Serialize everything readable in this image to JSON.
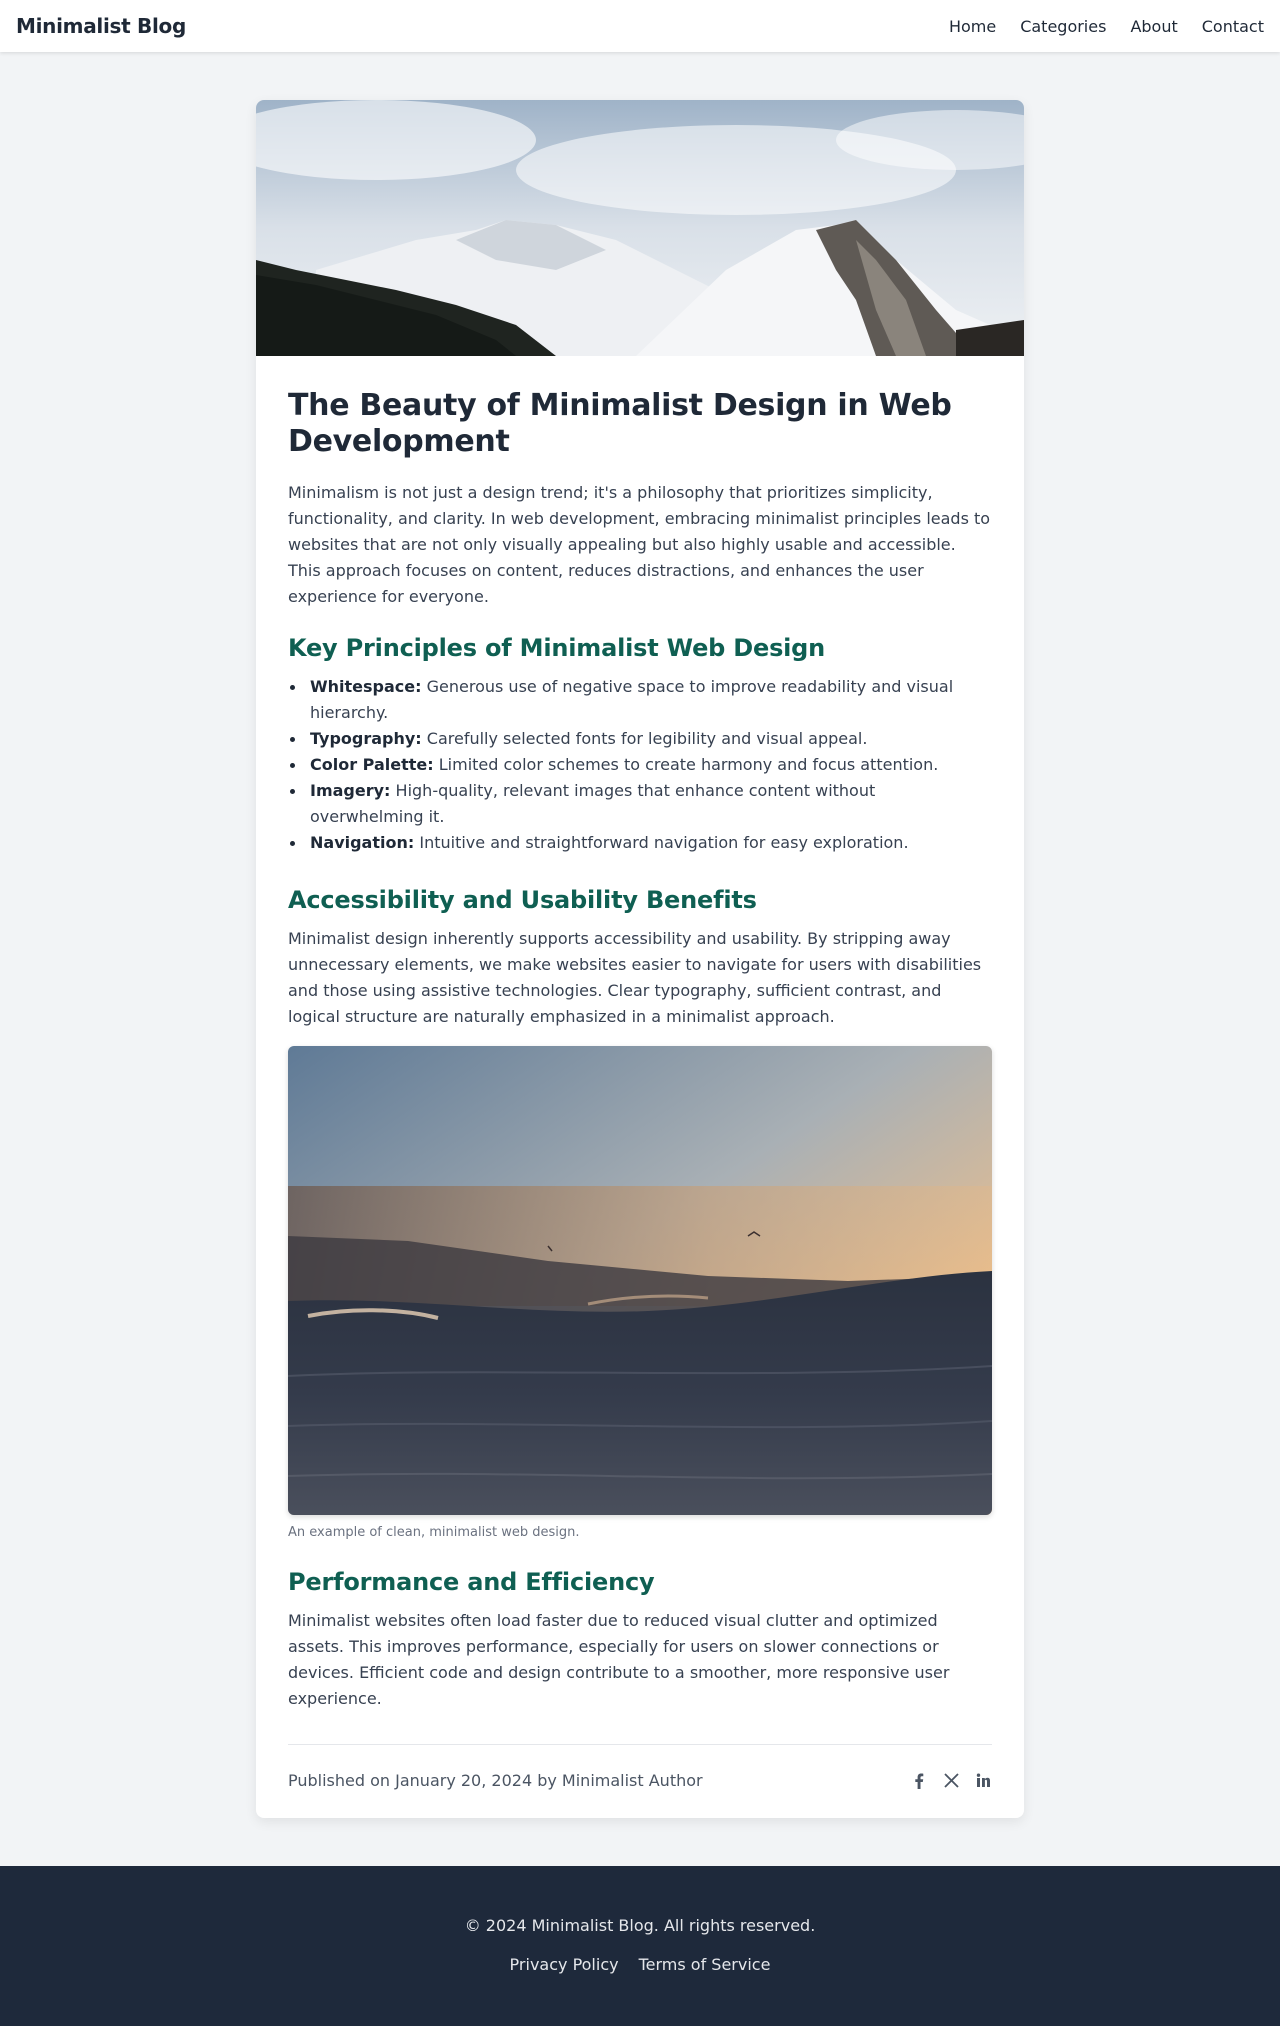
{
  "header": {
    "brand": "Minimalist Blog",
    "nav": [
      "Home",
      "Categories",
      "About",
      "Contact"
    ]
  },
  "article": {
    "title": "The Beauty of Minimalist Design in Web Development",
    "intro": "Minimalism is not just a design trend; it's a philosophy that prioritizes simplicity, functionality, and clarity. In web development, embracing minimalist principles leads to websites that are not only visually appealing but also highly usable and accessible. This approach focuses on content, reduces distractions, and enhances the user experience for everyone.",
    "principles_heading": "Key Principles of Minimalist Web Design",
    "principles": [
      {
        "term": "Whitespace:",
        "text": " Generous use of negative space to improve readability and visual hierarchy."
      },
      {
        "term": "Typography:",
        "text": " Carefully selected fonts for legibility and visual appeal."
      },
      {
        "term": "Color Palette:",
        "text": " Limited color schemes to create harmony and focus attention."
      },
      {
        "term": "Imagery:",
        "text": " High-quality, relevant images that enhance content without overwhelming it."
      },
      {
        "term": "Navigation:",
        "text": " Intuitive and straightforward navigation for easy exploration."
      }
    ],
    "accessibility_heading": "Accessibility and Usability Benefits",
    "accessibility_text": "Minimalist design inherently supports accessibility and usability. By stripping away unnecessary elements, we make websites easier to navigate for users with disabilities and those using assistive technologies. Clear typography, sufficient contrast, and logical structure are naturally emphasized in a minimalist approach.",
    "figure_caption": "An example of clean, minimalist web design.",
    "performance_heading": "Performance and Efficiency",
    "performance_text": "Minimalist websites often load faster due to reduced visual clutter and optimized assets. This improves performance, especially for users on slower connections or devices. Efficient code and design contribute to a smoother, more responsive user experience.",
    "published": "Published on January 20, 2024 by Minimalist Author",
    "social_icons": [
      "facebook-icon",
      "x-icon",
      "linkedin-icon"
    ]
  },
  "footer": {
    "copyright": "© 2024 Minimalist Blog. All rights reserved.",
    "links": [
      "Privacy Policy",
      "Terms of Service"
    ]
  },
  "colors": {
    "heading_accent": "#0f5f52",
    "footer_bg": "#1e293b",
    "page_bg": "#f2f4f6"
  }
}
